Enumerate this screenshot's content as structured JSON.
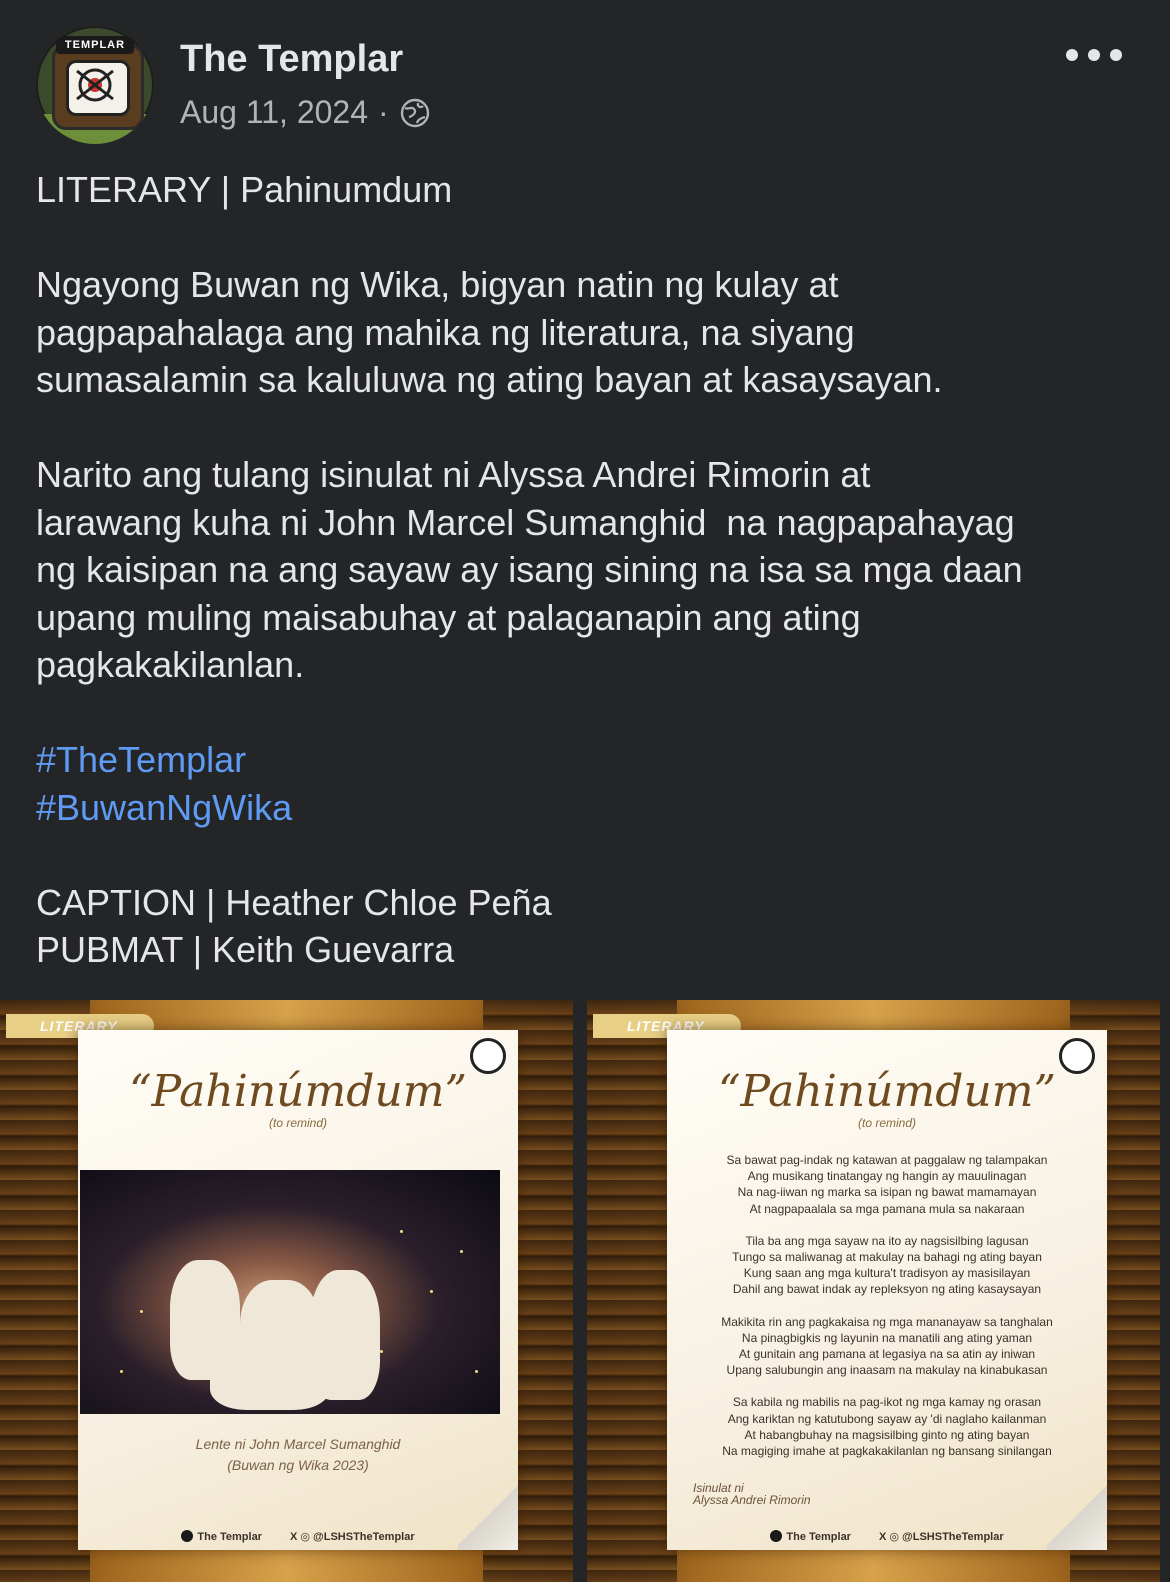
{
  "post": {
    "page_name": "The Templar",
    "date": "Aug 11, 2024",
    "separator": "·",
    "privacy_icon": "globe-icon",
    "avatar_text": "TEMPLAR",
    "more_icon": "more-horizontal-icon"
  },
  "body": {
    "line1": "LITERARY | Pahinumdum",
    "para1": [
      "Ngayong Buwan ng Wika, bigyan natin ng kulay at",
      "pagpapahalaga ang mahika ng literatura, na siyang",
      "sumasalamin sa kaluluwa ng ating bayan at kasaysayan."
    ],
    "para2": [
      "Narito ang tulang isinulat ni Alyssa Andrei Rimorin at",
      "larawang kuha ni John Marcel Sumanghid  na nagpapahayag",
      "ng kaisipan na ang sayaw ay isang sining na isa sa mga daan",
      "upang muling maisabuhay at palaganapin ang ating",
      "pagkakakilanlan."
    ],
    "hashtags": [
      "#TheTemplar",
      "#BuwanNgWika"
    ],
    "credits": [
      "CAPTION | Heather Chloe Peña",
      "PUBMAT | Keith Guevarra"
    ]
  },
  "images": {
    "tag": "LITERARY",
    "title": "“Pahinúmdum”",
    "subtitle": "(to remind)",
    "photo_credit": [
      "Lente ni John Marcel Sumanghid",
      "(Buwan ng Wika 2023)"
    ],
    "poem": [
      [
        "Sa bawat pag-indak ng katawan at paggalaw ng talampakan",
        "Ang musikang tinatangay ng hangin ay mauulinagan",
        "Na nag-iiwan ng marka sa isipan ng bawat mamamayan",
        "At nagpapaalala sa mga pamana mula sa nakaraan"
      ],
      [
        "Tila ba ang mga sayaw na ito ay nagsisilbing lagusan",
        "Tungo sa maliwanag at makulay na bahagi ng ating bayan",
        "Kung saan ang mga kultura't tradisyon ay masisilayan",
        "Dahil ang bawat indak ay repleksyon ng ating kasaysayan"
      ],
      [
        "Makikita rin ang pagkakaisa ng mga mananayaw sa tanghalan",
        "Na pinagbigkis ng layunin na manatili ang ating yaman",
        "At gunitain ang pamana at legasiya na sa atin ay iniwan",
        "Upang salubungin ang inaasam na makulay na kinabukasan"
      ],
      [
        "Sa kabila ng mabilis na pag-ikot ng mga kamay ng orasan",
        "Ang kariktan ng katutubong sayaw ay 'di naglaho kailanman",
        "At habangbuhay na magsisilbing ginto ng ating bayan",
        "Na magiging imahe at pagkakakilanlan ng bansang sinilangan"
      ]
    ],
    "author": [
      "Isinulat ni",
      "Alyssa Andrei Rimorin"
    ],
    "footer_fb": "The Templar",
    "footer_handle": "LSHSTheTemplar"
  }
}
